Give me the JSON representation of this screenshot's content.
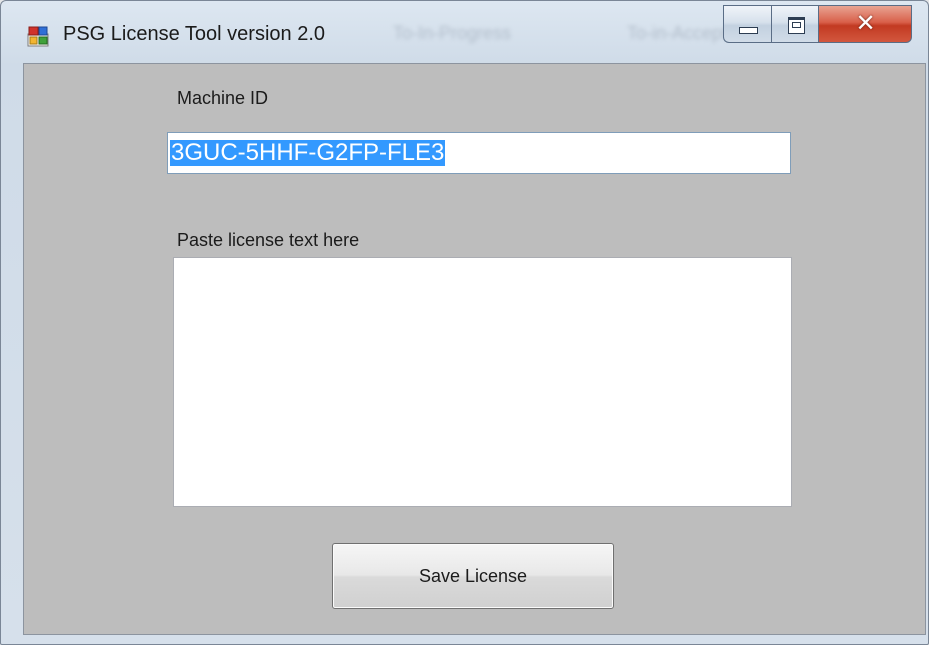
{
  "window": {
    "title": "PSG License Tool version 2.0",
    "background_titles": [
      "To-In-Progress",
      "To-in-Accepted"
    ]
  },
  "form": {
    "machine_id_label": "Machine ID",
    "machine_id_value": "3GUC-5HHF-G2FP-FLE3",
    "license_label": "Paste license text here",
    "license_value": "",
    "save_button": "Save License"
  },
  "icons": {
    "app": "application-icon",
    "minimize": "minimize-icon",
    "maximize": "maximize-icon",
    "close": "close-icon"
  },
  "colors": {
    "client_background": "#bdbdbd",
    "selection": "#3399ff",
    "close_button": "#c23a22"
  }
}
